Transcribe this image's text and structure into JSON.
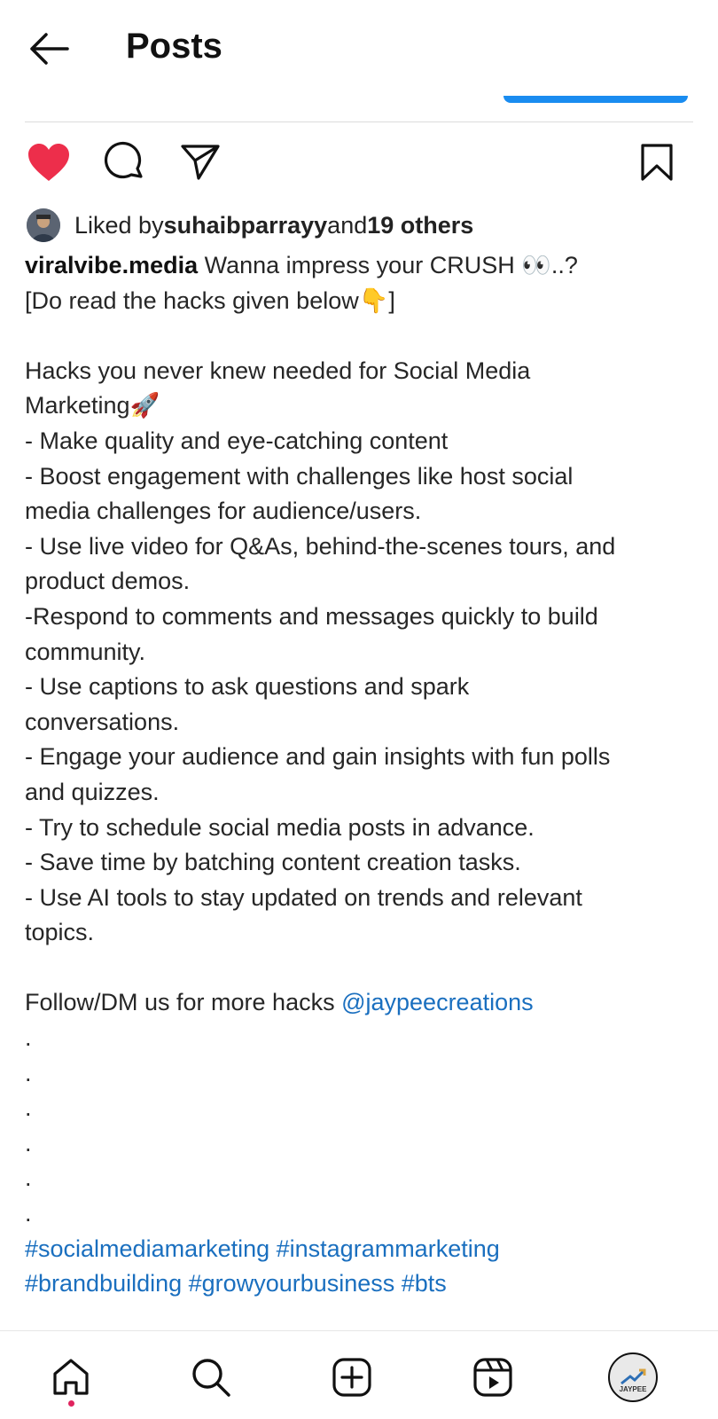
{
  "header": {
    "title": "Posts"
  },
  "likes": {
    "prefix": "Liked by ",
    "user": "suhaibparrayy",
    "middle": " and ",
    "others": "19 others"
  },
  "caption": {
    "username": "viralvibe.media",
    "first_line": " Wanna impress your CRUSH 👀..?",
    "lines": [
      "[Do read the hacks given below👇]",
      "",
      "Hacks you never knew needed for Social Media",
      "Marketing🚀",
      "- Make quality and eye-catching content",
      "- Boost engagement with challenges like host social",
      "media challenges for audience/users.",
      "- Use live video for Q&As, behind-the-scenes tours, and",
      "product demos.",
      "-Respond to comments and messages quickly to build",
      "community.",
      "- Use captions to ask questions and spark",
      "conversations.",
      "- Engage your audience and gain insights with fun polls",
      "and quizzes.",
      "- Try to schedule social media posts in advance.",
      "- Save time by batching content creation tasks.",
      "- Use AI tools to stay updated on trends and relevant",
      "topics.",
      ""
    ],
    "follow_text": "Follow/DM us for more hacks ",
    "mention": "@jaypeecreations",
    "dots": [
      ".",
      ".",
      ".",
      ".",
      ".",
      "."
    ],
    "hashtags_line1": "#socialmediamarketing #instagrammarketing",
    "hashtags_line2": "#brandbuilding #growyourbusiness #bts"
  },
  "profile_avatar_text": "JAYPEE",
  "icons": {
    "back": "back-arrow-icon",
    "like": "heart-filled-icon",
    "comment": "comment-icon",
    "share": "send-icon",
    "save": "bookmark-icon",
    "home": "home-icon",
    "search": "search-icon",
    "create": "add-post-icon",
    "reels": "reels-icon"
  },
  "colors": {
    "like": "#ed2e4b",
    "link": "#1a6fbf",
    "indicator": "#1a8cf0",
    "notification_dot": "#e0245e"
  }
}
